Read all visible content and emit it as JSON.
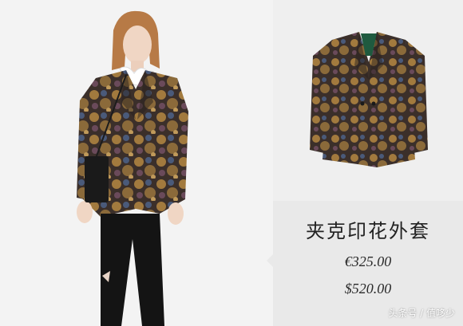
{
  "product": {
    "name": "夹克印花外套",
    "price_eur": "€325.00",
    "price_usd": "$520.00"
  },
  "watermark": "头条号 / 值哆少",
  "colors": {
    "fabric_base": "#3b2f2a",
    "fabric_gold": "#a27a3e",
    "fabric_blue": "#4a5a7a",
    "lining_green": "#1f5a3f",
    "panel_left": "#f3f3f3",
    "panel_right_bottom": "#e9e9e9"
  }
}
